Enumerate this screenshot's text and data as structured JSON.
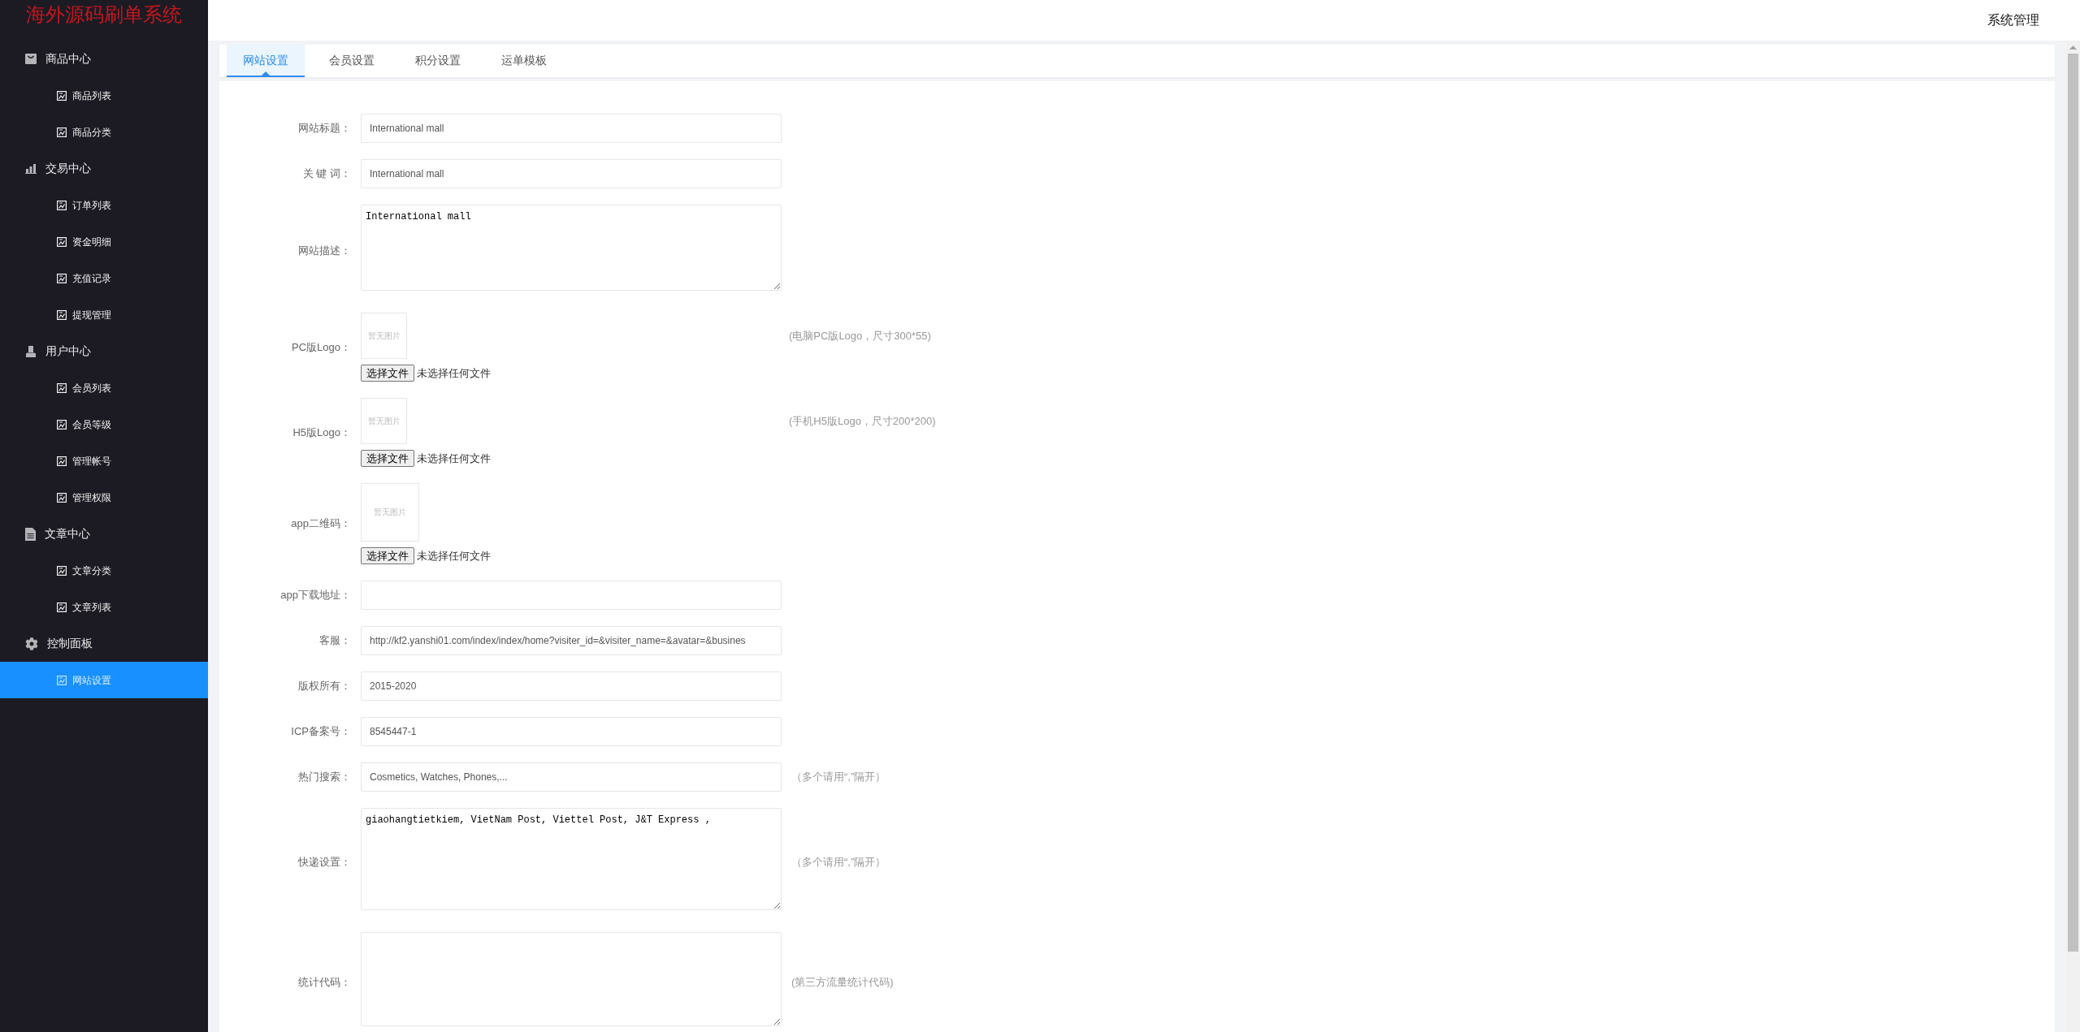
{
  "sidebar": {
    "title": "海外源码刷单系统",
    "groups": [
      {
        "label": "商品中心",
        "children": [
          {
            "label": "商品列表",
            "selected": false
          },
          {
            "label": "商品分类",
            "selected": false
          }
        ]
      },
      {
        "label": "交易中心",
        "children": [
          {
            "label": "订单列表",
            "selected": false
          },
          {
            "label": "资金明细",
            "selected": false
          },
          {
            "label": "充值记录",
            "selected": false
          },
          {
            "label": "提现管理",
            "selected": false
          }
        ]
      },
      {
        "label": "用户中心",
        "children": [
          {
            "label": "会员列表",
            "selected": false
          },
          {
            "label": "会员等级",
            "selected": false
          },
          {
            "label": "管理帐号",
            "selected": false
          },
          {
            "label": "管理权限",
            "selected": false
          }
        ]
      },
      {
        "label": "文章中心",
        "children": [
          {
            "label": "文章分类",
            "selected": false
          },
          {
            "label": "文章列表",
            "selected": false
          }
        ]
      },
      {
        "label": "控制面板",
        "children": [
          {
            "label": "网站设置",
            "selected": true
          }
        ]
      }
    ]
  },
  "header": {
    "menu": "系统管理"
  },
  "tabs": [
    {
      "label": "网站设置",
      "selected": true
    },
    {
      "label": "会员设置",
      "selected": false
    },
    {
      "label": "积分设置",
      "selected": false
    },
    {
      "label": "运单模板",
      "selected": false
    }
  ],
  "form": {
    "fields": [
      {
        "kind": "input",
        "label": "网站标题：",
        "value": "International mall"
      },
      {
        "kind": "input",
        "label": "关 键 词：",
        "value": "International mall"
      },
      {
        "kind": "textarea",
        "label": "网站描述：",
        "value": "International mall"
      },
      {
        "kind": "logo",
        "label": "PC版Logo：",
        "image_text": "暂无图片",
        "button": "选择文件",
        "file_status": "未选择任何文件",
        "hint": "(电脑PC版Logo，尺寸300*55)"
      },
      {
        "kind": "logo",
        "label": "H5版Logo：",
        "image_text": "暂无图片",
        "button": "选择文件",
        "file_status": "未选择任何文件",
        "hint": "(手机H5版Logo，尺寸200*200)"
      },
      {
        "kind": "qrcode",
        "label": "app二维码：",
        "image_text": "暂无图片",
        "button": "选择文件",
        "file_status": "未选择任何文件"
      },
      {
        "kind": "input",
        "label": "app下载地址："
      },
      {
        "kind": "input",
        "label": "客服：",
        "value": "http://kf2.yanshi01.com/index/index/home?visiter_id=&visiter_name=&avatar=&busines"
      },
      {
        "kind": "input",
        "label": "版权所有：",
        "value": "2015-2020"
      },
      {
        "kind": "input",
        "label": "ICP备案号：",
        "value": "8545447-1"
      },
      {
        "kind": "input",
        "label": "热门搜索：",
        "value": "Cosmetics, Watches, Phones,...",
        "hint": "（多个请用“,”隔开）"
      },
      {
        "kind": "textarea_large",
        "label": "快递设置：",
        "value": "giaohangtietkiem, VietNam Post, Viettel Post, J&T Express ,",
        "hint": "（多个请用“,”隔开）"
      },
      {
        "kind": "textarea_tall",
        "label": "统计代码：",
        "hint": "(第三方流量统计代码)"
      }
    ]
  }
}
